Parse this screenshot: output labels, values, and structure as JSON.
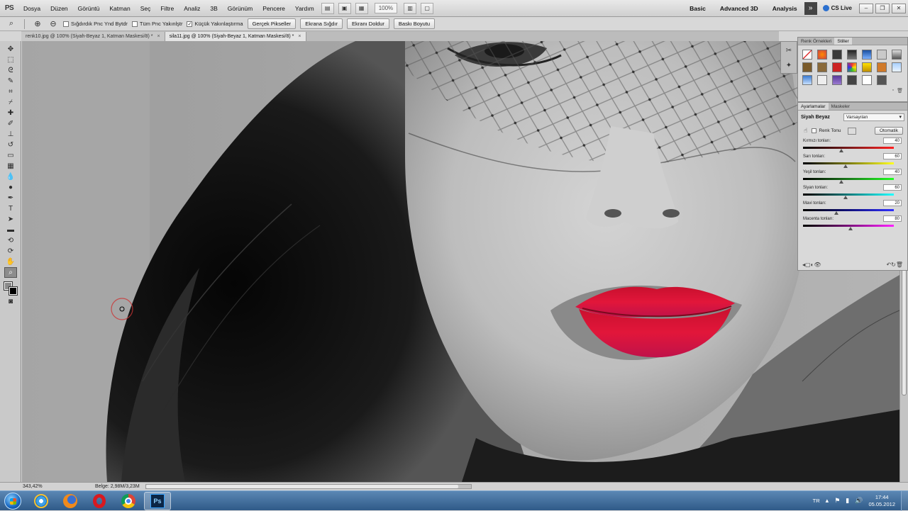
{
  "app": {
    "logo": "PS"
  },
  "menu": [
    "Dosya",
    "Düzen",
    "Görüntü",
    "Katman",
    "Seç",
    "Filtre",
    "Analiz",
    "3B",
    "Görünüm",
    "Pencere",
    "Yardım"
  ],
  "menubar": {
    "zoom_value": "100%",
    "workspaces": [
      "Basic",
      "Advanced 3D",
      "Analysis"
    ],
    "cs_live": "CS Live"
  },
  "options": {
    "resize_windows": "Sığdırdık Pnc Ynd Bytdr",
    "zoom_all": "Tüm Pnc Yakınlştr",
    "scrubby_zoom": "Küçük Yakınlaştırma",
    "actual_pixels": "Gerçek Pikseller",
    "fit_screen": "Ekrana Sığdır",
    "fill_screen": "Ekranı Doldur",
    "print_size": "Baskı Boyutu"
  },
  "tabs": [
    {
      "label": "renk10.jpg @ 100% (Siyah-Beyaz 1, Katman Maskesi/8) *",
      "active": false
    },
    {
      "label": "sila11.jpg @ 100% (Siyah-Beyaz 1, Katman Maskesi/8) *",
      "active": true
    }
  ],
  "status": {
    "zoom": "343,42%",
    "doc": "Belge: 2,98M/3,23M"
  },
  "panels": {
    "styles_tabs": [
      "Renk Örnekleri",
      "Stiller"
    ],
    "adj_tabs": [
      "Ayarlamalar",
      "Maskeler"
    ],
    "adj_title": "Siyah Beyaz",
    "adj_preset": "Varsayılan",
    "tint_label": "Renk Tonu",
    "auto_label": "Otomatik",
    "sliders": [
      {
        "label": "Kırmızı tonları:",
        "value": "40",
        "pct": 0.42,
        "gradient": "linear-gradient(90deg,#000,#7a1a1a,#ff2020)"
      },
      {
        "label": "Sarı tonları:",
        "value": "60",
        "pct": 0.47,
        "gradient": "linear-gradient(90deg,#000,#7a7a10,#ffff20)"
      },
      {
        "label": "Yeşil tonları:",
        "value": "40",
        "pct": 0.42,
        "gradient": "linear-gradient(90deg,#000,#1a7a1a,#20ff20)"
      },
      {
        "label": "Siyan tonları:",
        "value": "60",
        "pct": 0.47,
        "gradient": "linear-gradient(90deg,#000,#107a7a,#20ffff)"
      },
      {
        "label": "Mavi tonları:",
        "value": "20",
        "pct": 0.37,
        "gradient": "linear-gradient(90deg,#000,#10107a,#3030ff)"
      },
      {
        "label": "Macenta tonları:",
        "value": "80",
        "pct": 0.52,
        "gradient": "linear-gradient(90deg,#000,#7a107a,#ff20ff)"
      }
    ]
  },
  "taskbar": {
    "lang": "TR",
    "time": "17:44",
    "date": "05.05.2012"
  }
}
